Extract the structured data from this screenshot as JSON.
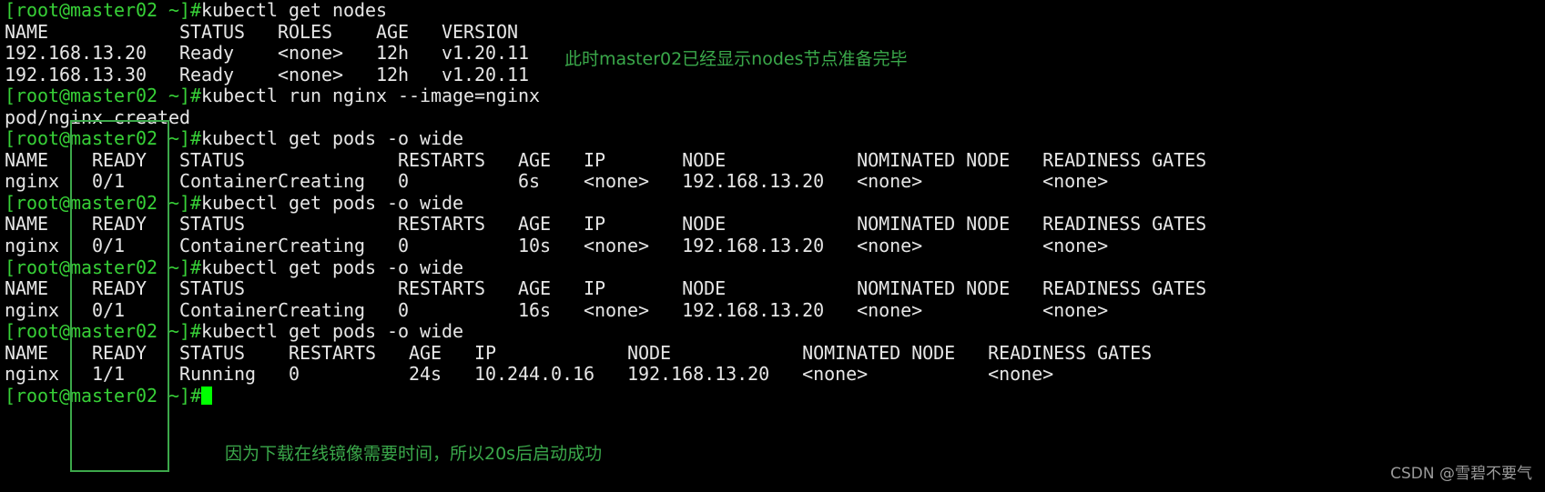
{
  "prompt": "[root@master02 ~]#",
  "lines": [
    {
      "type": "cmd",
      "text": "kubectl get nodes"
    },
    {
      "type": "out",
      "text": "NAME            STATUS   ROLES    AGE   VERSION"
    },
    {
      "type": "out",
      "text": "192.168.13.20   Ready    <none>   12h   v1.20.11"
    },
    {
      "type": "out",
      "text": "192.168.13.30   Ready    <none>   12h   v1.20.11"
    },
    {
      "type": "cmd",
      "text": "kubectl run nginx --image=nginx"
    },
    {
      "type": "out",
      "text": "pod/nginx created"
    },
    {
      "type": "cmd",
      "text": "kubectl get pods -o wide"
    },
    {
      "type": "out",
      "text": "NAME    READY   STATUS              RESTARTS   AGE   IP       NODE            NOMINATED NODE   READINESS GATES"
    },
    {
      "type": "out",
      "text": "nginx   0/1     ContainerCreating   0          6s    <none>   192.168.13.20   <none>           <none>"
    },
    {
      "type": "cmd",
      "text": "kubectl get pods -o wide"
    },
    {
      "type": "out",
      "text": "NAME    READY   STATUS              RESTARTS   AGE   IP       NODE            NOMINATED NODE   READINESS GATES"
    },
    {
      "type": "out",
      "text": "nginx   0/1     ContainerCreating   0          10s   <none>   192.168.13.20   <none>           <none>"
    },
    {
      "type": "cmd",
      "text": "kubectl get pods -o wide"
    },
    {
      "type": "out",
      "text": "NAME    READY   STATUS              RESTARTS   AGE   IP       NODE            NOMINATED NODE   READINESS GATES"
    },
    {
      "type": "out",
      "text": "nginx   0/1     ContainerCreating   0          16s   <none>   192.168.13.20   <none>           <none>"
    },
    {
      "type": "cmd",
      "text": "kubectl get pods -o wide"
    },
    {
      "type": "out",
      "text": "NAME    READY   STATUS    RESTARTS   AGE   IP            NODE            NOMINATED NODE   READINESS GATES"
    },
    {
      "type": "out",
      "text": "nginx   1/1     Running   0          24s   10.244.0.16   192.168.13.20   <none>           <none>"
    },
    {
      "type": "input",
      "text": ""
    }
  ],
  "annotations": {
    "nodes_ready": "此时master02已经显示nodes节点准备完毕",
    "startup_delay": "因为下载在线镜像需要时间，所以20s后启动成功"
  },
  "watermark": "CSDN @雪碧不要气",
  "colors": {
    "prompt": "#37d037",
    "annotation": "#3aa84a",
    "cursor": "#00ff00",
    "box": "#3ca84a"
  }
}
